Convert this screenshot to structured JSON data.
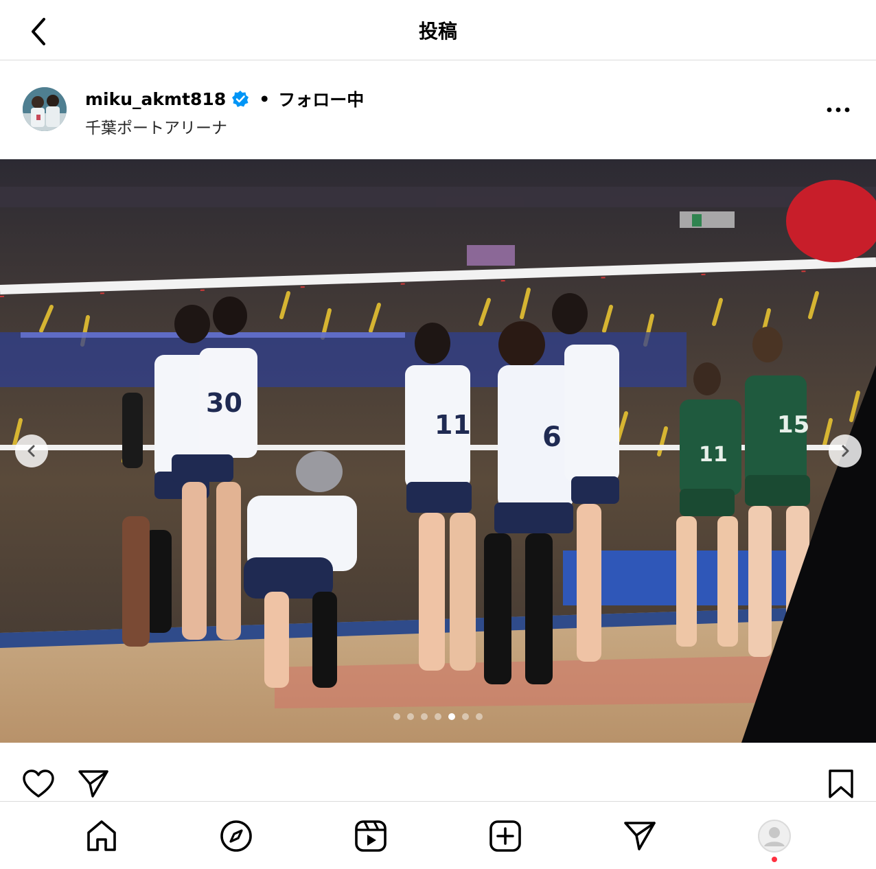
{
  "header": {
    "title": "投稿"
  },
  "post": {
    "username": "miku_akmt818",
    "verified": true,
    "separator": "•",
    "follow_status": "フォロー中",
    "location": "千葉ポートアリーナ"
  },
  "carousel": {
    "total_slides": 7,
    "active_slide": 5
  },
  "jerseys": [
    "30",
    "11",
    "6",
    "15",
    "11"
  ],
  "icons": {
    "back": "chevron-left-icon",
    "more": "more-horizontal-icon",
    "like": "heart-icon",
    "share": "paper-plane-icon",
    "save": "bookmark-icon",
    "home": "home-icon",
    "explore": "compass-icon",
    "reels": "reels-icon",
    "create": "plus-square-icon",
    "messages": "paper-plane-icon",
    "profile": "profile-avatar-icon"
  },
  "colors": {
    "verified": "#0095f6",
    "notification_dot": "#ff3040",
    "divider": "#dbdbdb"
  }
}
